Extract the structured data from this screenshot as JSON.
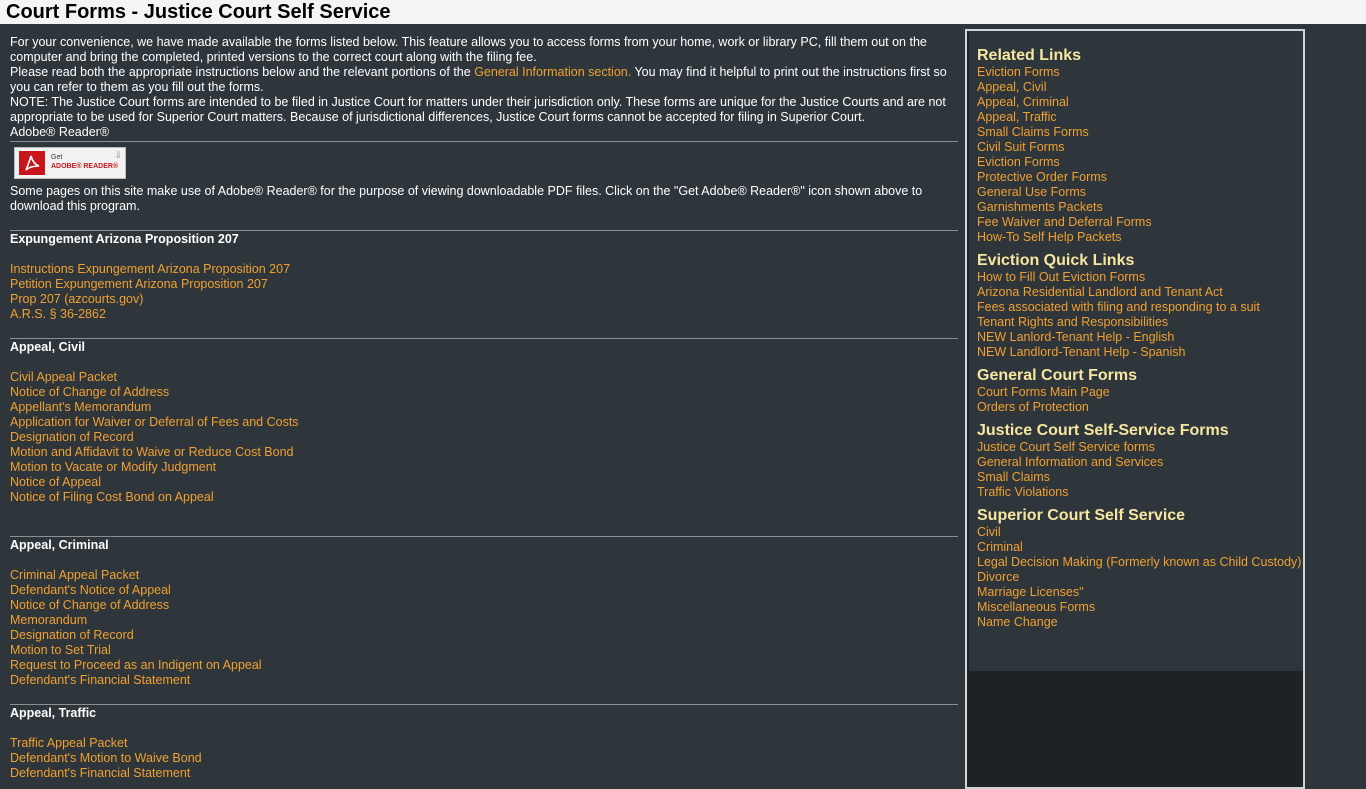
{
  "page": {
    "title": "Court Forms - Justice Court Self Service"
  },
  "intro": {
    "p1": "For your convenience, we have made available the forms listed below. This feature allows you to access forms from your home, work or library PC, fill them out on the computer and bring the completed, printed versions to the correct court along with the filing fee.",
    "p2_before": "Please read both the appropriate instructions below and the relevant portions of the ",
    "p2_link": "General Information section.",
    "p2_after": " You may find it helpful to print out the instructions first so you can refer to them as you fill out the forms.",
    "p3": "NOTE: The Justice Court forms are intended to be filed in Justice Court for matters under their jurisdiction only. These forms are unique for the Justice Courts and are not appropriate to be used for Superior Court matters. Because of jurisdictional differences, Justice Court forms cannot be accepted for filing in Superior Court.",
    "p4": "Adobe® Reader®"
  },
  "adobe": {
    "get": "Get",
    "reader": "ADOBE® READER®",
    "note": "Some pages on this site make use of Adobe® Reader® for the purpose of viewing downloadable PDF files. Click on the \"Get Adobe® Reader®\" icon shown above to download this program."
  },
  "sections": [
    {
      "heading": "Expungement Arizona Proposition 207",
      "links": [
        "Instructions Expungement Arizona Proposition 207",
        "Petition Expungement Arizona Proposition 207",
        "Prop 207 (azcourts.gov)",
        "A.R.S. § 36-2862"
      ]
    },
    {
      "heading": "Appeal, Civil",
      "links": [
        "Civil Appeal Packet",
        "Notice of Change of Address",
        "Appellant's Memorandum",
        "Application for Waiver or Deferral of Fees and Costs",
        "Designation of Record",
        "Motion and Affidavit to Waive or Reduce Cost Bond",
        "Motion to Vacate or Modify Judgment",
        "Notice of Appeal",
        "Notice of Filing Cost Bond on Appeal"
      ]
    },
    {
      "heading": "Appeal, Criminal",
      "links": [
        "Criminal Appeal Packet",
        "Defendant's Notice of Appeal",
        "Notice of Change of Address",
        "Memorandum",
        "Designation of Record",
        "Motion to Set Trial",
        "Request to Proceed as an Indigent on Appeal",
        "Defendant's Financial Statement"
      ]
    },
    {
      "heading": "Appeal, Traffic",
      "links": [
        "Traffic Appeal Packet",
        "Defendant's Motion to Waive Bond",
        "Defendant's Financial Statement"
      ]
    }
  ],
  "sidebar": {
    "groups": [
      {
        "heading": "Related Links",
        "links": [
          "Eviction Forms",
          "Appeal, Civil",
          "Appeal, Criminal",
          "Appeal, Traffic",
          "Small Claims Forms",
          "Civil Suit Forms",
          "Eviction Forms",
          "Protective Order Forms",
          "General Use Forms",
          "Garnishments Packets",
          "Fee Waiver and Deferral Forms",
          "How-To Self Help Packets"
        ]
      },
      {
        "heading": "Eviction Quick Links",
        "links": [
          "How to Fill Out Eviction Forms",
          "Arizona Residential Landlord and Tenant Act",
          "Fees associated with filing and responding to a suit",
          "Tenant Rights and Responsibilities",
          "NEW Lanlord-Tenant Help - English",
          "NEW Landlord-Tenant Help - Spanish"
        ]
      },
      {
        "heading": "General Court Forms",
        "links": [
          "Court Forms Main Page",
          "Orders of Protection"
        ]
      },
      {
        "heading": "Justice Court Self-Service Forms",
        "links": [
          "Justice Court Self Service forms",
          "General Information and Services",
          "Small Claims",
          "Traffic Violations"
        ]
      },
      {
        "heading": "Superior Court Self Service",
        "links": [
          "Civil",
          "Criminal",
          "Legal Decision Making (Formerly known as Child Custody)",
          "Divorce",
          "Marriage Licenses\"",
          "Miscellaneous Forms",
          "Name Change"
        ]
      }
    ]
  },
  "colors": {
    "background": "#2e363c",
    "link": "#f0a030",
    "sidebar_heading": "#f5e6a0",
    "text": "#ffffff",
    "title_bar": "#f4f4f4"
  }
}
